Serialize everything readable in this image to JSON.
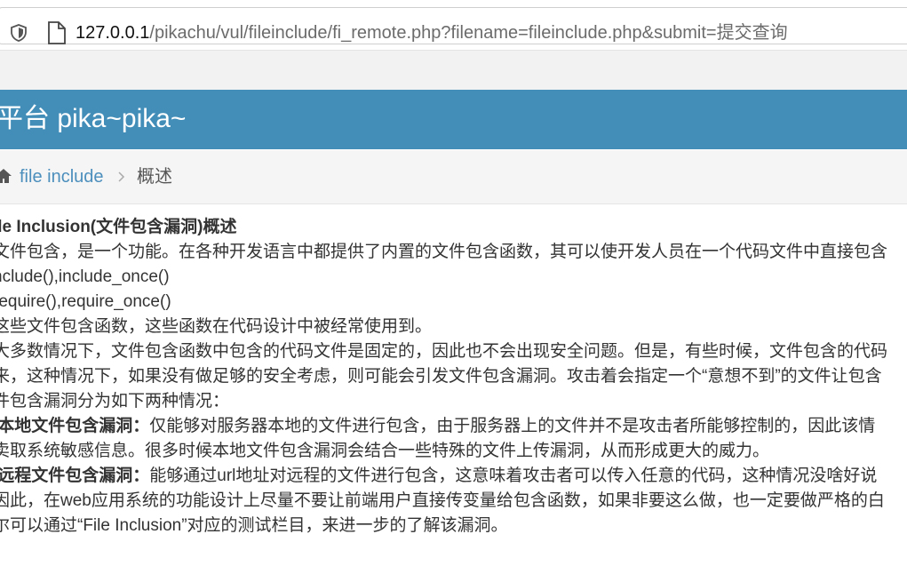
{
  "browser": {
    "url_host": "127.0.0.1",
    "url_path": "/pikachu/vul/fileinclude/fi_remote.php?filename=fileinclude.php&submit=提交查询"
  },
  "banner": {
    "title": "平台 pika~pika~"
  },
  "breadcrumb": {
    "parent": "file include",
    "current": "概述"
  },
  "content": {
    "heading": "ile Inclusion(文件包含漏洞)概述",
    "lines": [
      "文件包含，是一个功能。在各种开发语言中都提供了内置的文件包含函数，其可以使开发人员在一个代码文件中直接包含",
      "nclude(),include_once()",
      "require(),require_once()",
      "这些文件包含函数，这些函数在代码设计中被经常使用到。",
      "大多数情况下，文件包含函数中包含的代码文件是固定的，因此也不会出现安全问题。但是，有些时候，文件包含的代码",
      "来，这种情况下，如果没有做足够的安全考虑，则可能会引发文件包含漏洞。攻击着会指定一个“意想不到”的文件让包含",
      "件包含漏洞分为如下两种情况："
    ],
    "local": {
      "label": ".本地文件包含漏洞：",
      "text": "仅能够对服务器本地的文件进行包含，由于服务器上的文件并不是攻击者所能够控制的，因此该情",
      "cont": "卖取系统敏感信息。很多时候本地文件包含漏洞会结合一些特殊的文件上传漏洞，从而形成更大的威力。"
    },
    "remote": {
      "label": ".远程文件包含漏洞：",
      "text": "能够通过url地址对远程的文件进行包含，这意味着攻击者可以传入任意的代码，这种情况没啥好说"
    },
    "tail": [
      "因此，在web应用系统的功能设计上尽量不要让前端用户直接传变量给包含函数，如果非要这么做，也一定要做严格的白",
      "尔可以通过“File Inclusion”对应的测试栏目，来进一步的了解该漏洞。"
    ]
  }
}
